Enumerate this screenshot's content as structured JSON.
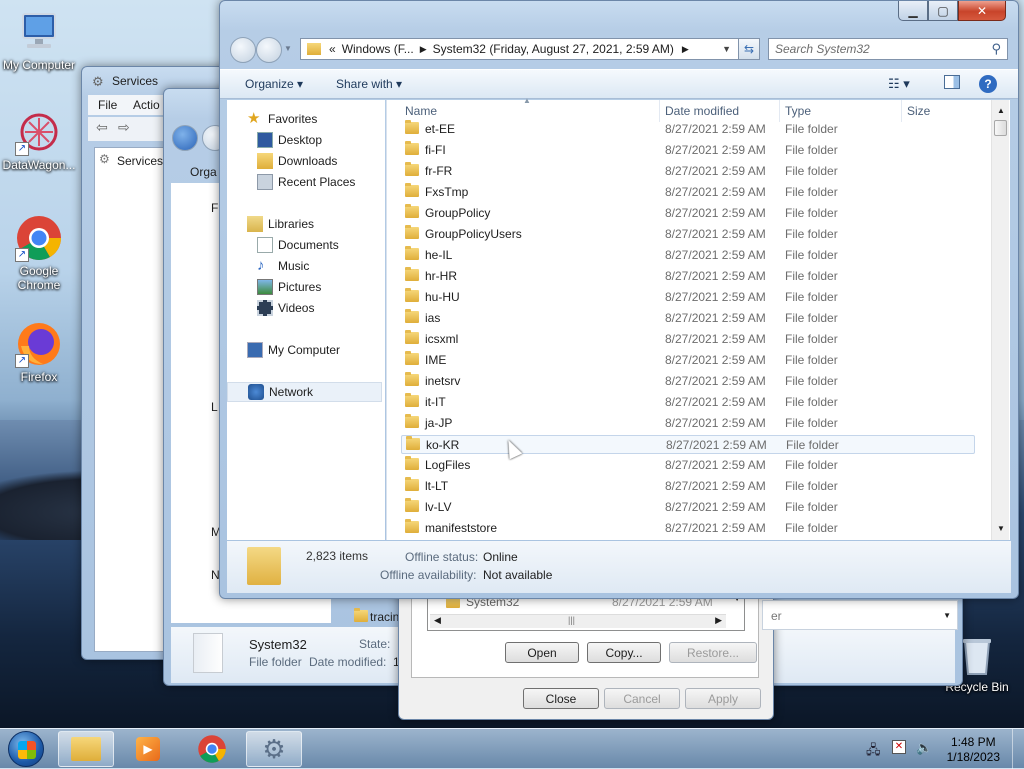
{
  "desktop": {
    "icons": [
      {
        "label": "My Computer"
      },
      {
        "label": "DataWagon..."
      },
      {
        "label": "Google Chrome"
      },
      {
        "label": "Firefox"
      },
      {
        "label": "Recycle Bin"
      }
    ]
  },
  "back_window_services": {
    "title": "Services",
    "menu": [
      "File",
      "Actio"
    ],
    "tree_item": "Services"
  },
  "back_window_explorer2": {
    "organize": "Orga",
    "nav_letters": [
      "F",
      "L",
      "M",
      "N"
    ],
    "footer_name": "System32",
    "footer_type": "File folder",
    "footer_state_label": "State:",
    "footer_date_label": "Date modified:",
    "footer_date_value": "1",
    "list_item": "tracin"
  },
  "dialog": {
    "list_item_name": "System32",
    "list_item_date": "8/27/2021 2:59 AM",
    "buttons": {
      "open": "Open",
      "copy": "Copy...",
      "restore": "Restore..."
    },
    "footer_buttons": {
      "close": "Close",
      "cancel": "Cancel",
      "apply": "Apply"
    },
    "side_text": "er"
  },
  "explorer": {
    "address": {
      "prefix": "«",
      "crumb1": "Windows (F...",
      "crumb2": "System32 (Friday, August 27, 2021, 2:59 AM)"
    },
    "search_placeholder": "Search System32",
    "toolbar": {
      "organize": "Organize",
      "share": "Share with"
    },
    "nav": {
      "favorites": "Favorites",
      "desktop": "Desktop",
      "downloads": "Downloads",
      "recent": "Recent Places",
      "libraries": "Libraries",
      "documents": "Documents",
      "music": "Music",
      "pictures": "Pictures",
      "videos": "Videos",
      "computer": "My Computer",
      "network": "Network"
    },
    "columns": {
      "name": "Name",
      "date": "Date modified",
      "type": "Type",
      "size": "Size"
    },
    "rows": [
      {
        "name": "et-EE",
        "date": "8/27/2021 2:59 AM",
        "type": "File folder"
      },
      {
        "name": "fi-FI",
        "date": "8/27/2021 2:59 AM",
        "type": "File folder"
      },
      {
        "name": "fr-FR",
        "date": "8/27/2021 2:59 AM",
        "type": "File folder"
      },
      {
        "name": "FxsTmp",
        "date": "8/27/2021 2:59 AM",
        "type": "File folder"
      },
      {
        "name": "GroupPolicy",
        "date": "8/27/2021 2:59 AM",
        "type": "File folder"
      },
      {
        "name": "GroupPolicyUsers",
        "date": "8/27/2021 2:59 AM",
        "type": "File folder"
      },
      {
        "name": "he-IL",
        "date": "8/27/2021 2:59 AM",
        "type": "File folder"
      },
      {
        "name": "hr-HR",
        "date": "8/27/2021 2:59 AM",
        "type": "File folder"
      },
      {
        "name": "hu-HU",
        "date": "8/27/2021 2:59 AM",
        "type": "File folder"
      },
      {
        "name": "ias",
        "date": "8/27/2021 2:59 AM",
        "type": "File folder"
      },
      {
        "name": "icsxml",
        "date": "8/27/2021 2:59 AM",
        "type": "File folder"
      },
      {
        "name": "IME",
        "date": "8/27/2021 2:59 AM",
        "type": "File folder"
      },
      {
        "name": "inetsrv",
        "date": "8/27/2021 2:59 AM",
        "type": "File folder"
      },
      {
        "name": "it-IT",
        "date": "8/27/2021 2:59 AM",
        "type": "File folder"
      },
      {
        "name": "ja-JP",
        "date": "8/27/2021 2:59 AM",
        "type": "File folder"
      },
      {
        "name": "ko-KR",
        "date": "8/27/2021 2:59 AM",
        "type": "File folder"
      },
      {
        "name": "LogFiles",
        "date": "8/27/2021 2:59 AM",
        "type": "File folder"
      },
      {
        "name": "lt-LT",
        "date": "8/27/2021 2:59 AM",
        "type": "File folder"
      },
      {
        "name": "lv-LV",
        "date": "8/27/2021 2:59 AM",
        "type": "File folder"
      },
      {
        "name": "manifeststore",
        "date": "8/27/2021 2:59 AM",
        "type": "File folder"
      }
    ],
    "details": {
      "count": "2,823 items",
      "offline_status_label": "Offline status:",
      "offline_status_value": "Online",
      "offline_avail_label": "Offline availability:",
      "offline_avail_value": "Not available"
    }
  },
  "taskbar": {
    "time": "1:48 PM",
    "date": "1/18/2023"
  }
}
